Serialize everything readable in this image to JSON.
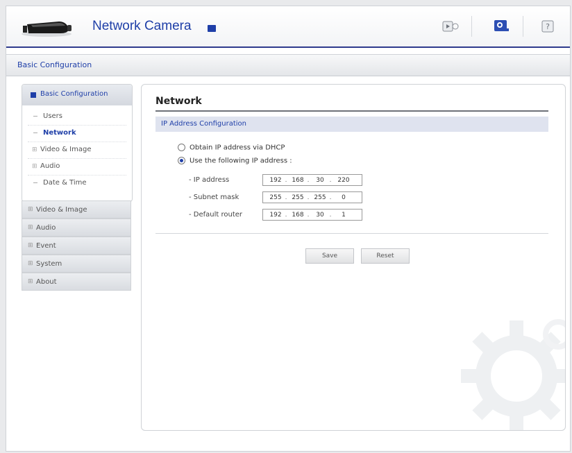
{
  "header": {
    "app_title": "Network Camera",
    "icons": [
      "camera-logo-icon",
      "live-view-icon",
      "setup-icon",
      "help-icon"
    ]
  },
  "breadcrumb": {
    "label": "Basic Configuration"
  },
  "sidebar": {
    "active_section": "Basic Configuration",
    "sub_items": [
      {
        "label": "Users",
        "marker": "dash"
      },
      {
        "label": "Network",
        "marker": "dash",
        "active": true
      },
      {
        "label": "Video & Image",
        "marker": "plus"
      },
      {
        "label": "Audio",
        "marker": "plus"
      },
      {
        "label": "Date & Time",
        "marker": "dash"
      }
    ],
    "sections": [
      {
        "label": "Video & Image"
      },
      {
        "label": "Audio"
      },
      {
        "label": "Event"
      },
      {
        "label": "System"
      },
      {
        "label": "About"
      }
    ]
  },
  "main": {
    "title": "Network",
    "section_title": "IP Address Configuration",
    "radio_dhcp": "Obtain IP address via DHCP",
    "radio_static": "Use the following IP address :",
    "selected_mode": "static",
    "fields": [
      {
        "label": "- IP address",
        "octets": [
          "192",
          "168",
          "30",
          "220"
        ]
      },
      {
        "label": "- Subnet mask",
        "octets": [
          "255",
          "255",
          "255",
          "0"
        ]
      },
      {
        "label": "- Default router",
        "octets": [
          "192",
          "168",
          "30",
          "1"
        ]
      }
    ],
    "octet_separator": ".",
    "save_label": "Save",
    "reset_label": "Reset"
  },
  "colors": {
    "accent": "#1f3fa8",
    "header_rule": "#2d3a8c",
    "section_bar": "#dfe3ef"
  }
}
